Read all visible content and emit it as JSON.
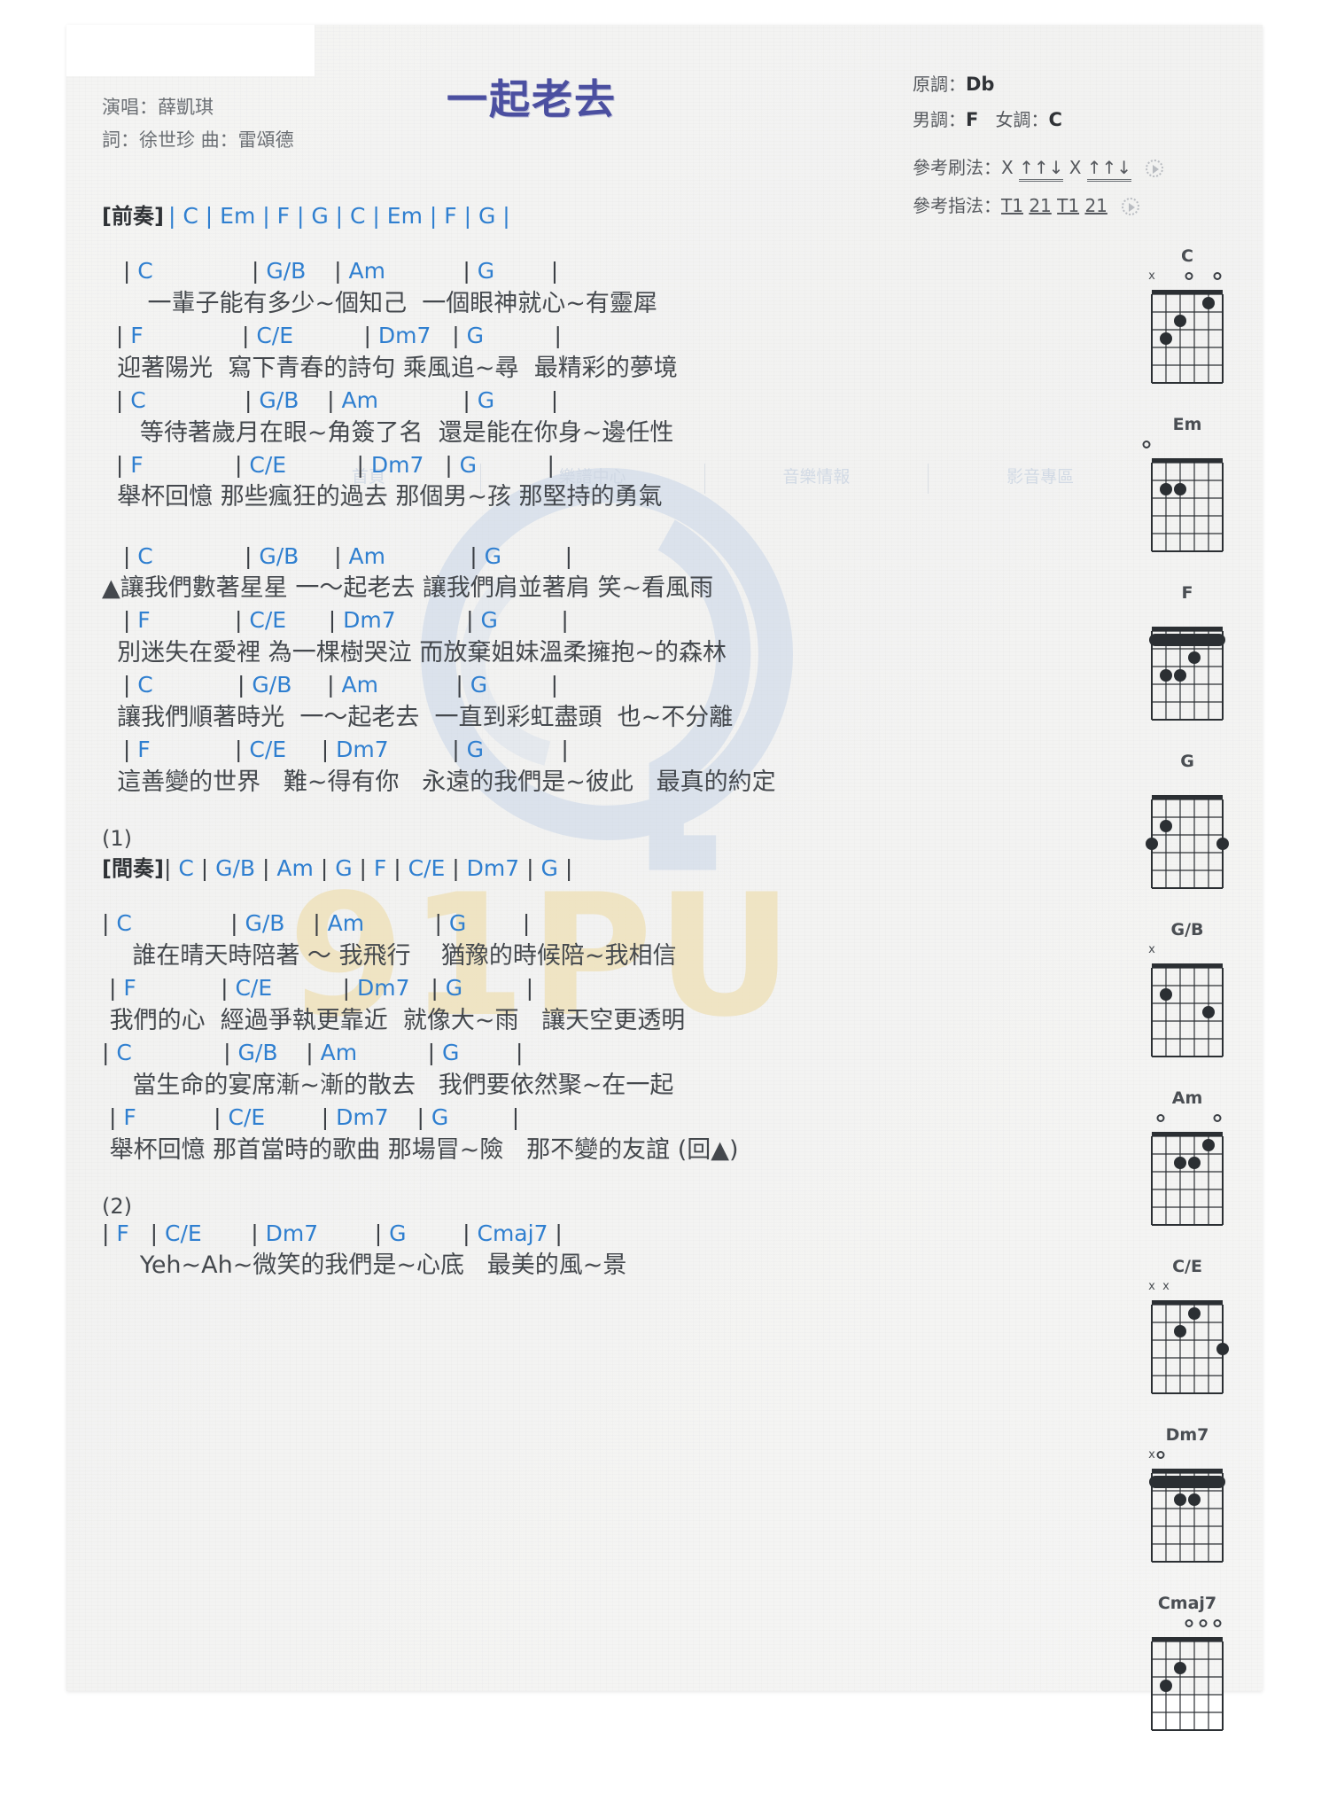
{
  "header": {
    "title": "一起老去",
    "singer_label": "演唱：薛凱琪",
    "credits_label": "詞：徐世珍  曲：雷頌德",
    "original_key_label": "原調：",
    "original_key": "Db",
    "male_key_label": "男調：",
    "male_key": "F",
    "female_key_label": "女調：",
    "female_key": "C",
    "strum_label": "參考刷法：",
    "strum_pattern_a": "X",
    "strum_pattern_b": "↑↑↓",
    "strum_pattern_c": "X",
    "strum_pattern_d": "↑↑↓",
    "finger_label": "參考指法：",
    "finger_a": "T1",
    "finger_b": "21",
    "finger_c": "T1",
    "finger_d": "21",
    "speaker_icon": "speaker-icon"
  },
  "watermark": {
    "brand": "91PU",
    "nav": [
      "首頁",
      "樂譜中心",
      "音樂情報",
      "影音專區"
    ]
  },
  "intro": {
    "label": "[前奏]",
    "sequence": "| C | Em | F | G | C | Em | F | G |"
  },
  "interlude": {
    "marker": "(1)",
    "label": "[間奏]",
    "sequence": "| C | G/B | Am | G | F | C/E | Dm7 | G |"
  },
  "ending": {
    "marker": "(2)"
  },
  "sections": [
    {
      "name": "verse-1",
      "lines": [
        {
          "chords": "   | C              | G/B    | Am           | G        |",
          "lyric": "      一輩子能有多少~個知己  一個眼神就心~有靈犀"
        },
        {
          "chords": "  | F              | C/E          | Dm7   | G          |",
          "lyric": "  迎著陽光  寫下青春的詩句 乘風追~尋  最精彩的夢境"
        },
        {
          "chords": "  | C              | G/B    | Am            | G        |",
          "lyric": "     等待著歲月在眼~角簽了名  還是能在你身~邊任性"
        },
        {
          "chords": "  | F             | C/E          | Dm7   | G          |",
          "lyric": "  舉杯回憶 那些瘋狂的過去 那個男~孩 那堅持的勇氣"
        }
      ]
    },
    {
      "name": "chorus",
      "lines": [
        {
          "chords": "   | C             | G/B     | Am            | G         |",
          "lyric": "▲讓我們數著星星 一～起老去 讓我們肩並著肩 笑~看風雨"
        },
        {
          "chords": "   | F            | C/E      | Dm7          | G         |",
          "lyric": "  別迷失在愛裡 為一棵樹哭泣 而放棄姐妹溫柔擁抱~的森林"
        },
        {
          "chords": "   | C            | G/B     | Am           | G         |",
          "lyric": "  讓我們順著時光  一～起老去  一直到彩虹盡頭  也~不分離"
        },
        {
          "chords": "   | F            | C/E     | Dm7         | G           |",
          "lyric": "  這善變的世界   難~得有你   永遠的我們是~彼此   最真的約定"
        }
      ]
    },
    {
      "name": "verse-2",
      "lines": [
        {
          "chords": "| C              | G/B    | Am          | G        |",
          "lyric": "    誰在晴天時陪著 ～ 我飛行    猶豫的時候陪~我相信"
        },
        {
          "chords": " | F            | C/E          | Dm7   | G         |",
          "lyric": " 我們的心  經過爭執更靠近  就像大~雨   讓天空更透明"
        },
        {
          "chords": "| C             | G/B    | Am          | G        |",
          "lyric": "    當生命的宴席漸~漸的散去   我們要依然聚~在一起"
        },
        {
          "chords": " | F           | C/E        | Dm7    | G         |",
          "lyric": " 舉杯回憶 那首當時的歌曲 那場冒~險   那不變的友誼 (回▲)"
        }
      ]
    },
    {
      "name": "ending-line",
      "lines": [
        {
          "chords": "| F   | C/E       | Dm7        | G        | Cmaj7 |",
          "lyric": "     Yeh~Ah~微笑的我們是~心底   最美的風~景"
        }
      ]
    }
  ],
  "chord_diagrams": [
    {
      "name": "C",
      "markers": [
        {
          "s": 6,
          "t": "x"
        },
        {
          "s": 3,
          "t": "o"
        },
        {
          "s": 1,
          "t": "o"
        }
      ],
      "dots": [
        {
          "s": 5,
          "f": 3
        },
        {
          "s": 4,
          "f": 2
        },
        {
          "s": 2,
          "f": 1
        }
      ],
      "barre": null
    },
    {
      "name": "Em",
      "markers": [
        {
          "s": 6,
          "t": "o"
        }
      ],
      "dots": [
        {
          "s": 5,
          "f": 2
        },
        {
          "s": 4,
          "f": 2
        }
      ],
      "barre": null
    },
    {
      "name": "F",
      "markers": [],
      "dots": [
        {
          "s": 5,
          "f": 3
        },
        {
          "s": 4,
          "f": 3
        },
        {
          "s": 3,
          "f": 2
        }
      ],
      "barre": 1
    },
    {
      "name": "G",
      "markers": [],
      "dots": [
        {
          "s": 6,
          "f": 3
        },
        {
          "s": 5,
          "f": 2
        },
        {
          "s": 1,
          "f": 3
        }
      ],
      "barre": null
    },
    {
      "name": "G/B",
      "markers": [
        {
          "s": 6,
          "t": "x"
        }
      ],
      "dots": [
        {
          "s": 5,
          "f": 2
        },
        {
          "s": 2,
          "f": 3
        }
      ],
      "barre": null
    },
    {
      "name": "Am",
      "markers": [
        {
          "s": 5,
          "t": "o"
        },
        {
          "s": 1,
          "t": "o"
        }
      ],
      "dots": [
        {
          "s": 4,
          "f": 2
        },
        {
          "s": 3,
          "f": 2
        },
        {
          "s": 2,
          "f": 1
        }
      ],
      "barre": null
    },
    {
      "name": "C/E",
      "markers": [
        {
          "s": 6,
          "t": "x"
        },
        {
          "s": 5,
          "t": "x"
        }
      ],
      "dots": [
        {
          "s": 4,
          "f": 2
        },
        {
          "s": 3,
          "f": 1
        },
        {
          "s": 1,
          "f": 3
        }
      ],
      "barre": null
    },
    {
      "name": "Dm7",
      "markers": [
        {
          "s": 6,
          "t": "x"
        },
        {
          "s": 5,
          "t": "o"
        }
      ],
      "dots": [
        {
          "s": 4,
          "f": 2
        },
        {
          "s": 3,
          "f": 2
        }
      ],
      "barre": 1
    },
    {
      "name": "Cmaj7",
      "markers": [
        {
          "s": 3,
          "t": "o"
        },
        {
          "s": 2,
          "t": "o"
        },
        {
          "s": 1,
          "t": "o"
        }
      ],
      "dots": [
        {
          "s": 5,
          "f": 3
        },
        {
          "s": 4,
          "f": 2
        }
      ],
      "barre": null
    }
  ],
  "colors": {
    "chord": "#2f7fd0",
    "title": "#4b4fa0",
    "lyric": "#44484d",
    "watermark_blue": "#c9d6e8",
    "watermark_gold": "#efe2bc"
  }
}
